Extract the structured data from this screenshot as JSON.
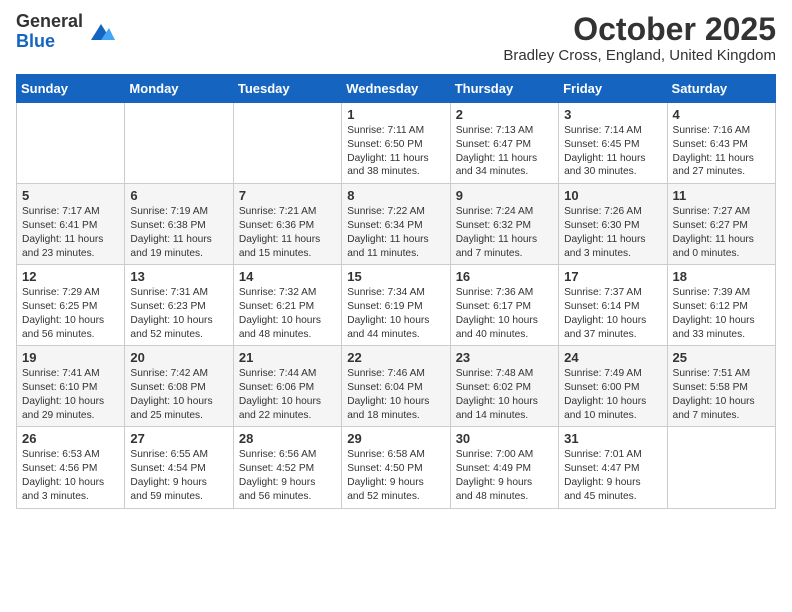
{
  "logo": {
    "general": "General",
    "blue": "Blue"
  },
  "header": {
    "month": "October 2025",
    "location": "Bradley Cross, England, United Kingdom"
  },
  "weekdays": [
    "Sunday",
    "Monday",
    "Tuesday",
    "Wednesday",
    "Thursday",
    "Friday",
    "Saturday"
  ],
  "weeks": [
    [
      {
        "day": "",
        "info": ""
      },
      {
        "day": "",
        "info": ""
      },
      {
        "day": "",
        "info": ""
      },
      {
        "day": "1",
        "info": "Sunrise: 7:11 AM\nSunset: 6:50 PM\nDaylight: 11 hours\nand 38 minutes."
      },
      {
        "day": "2",
        "info": "Sunrise: 7:13 AM\nSunset: 6:47 PM\nDaylight: 11 hours\nand 34 minutes."
      },
      {
        "day": "3",
        "info": "Sunrise: 7:14 AM\nSunset: 6:45 PM\nDaylight: 11 hours\nand 30 minutes."
      },
      {
        "day": "4",
        "info": "Sunrise: 7:16 AM\nSunset: 6:43 PM\nDaylight: 11 hours\nand 27 minutes."
      }
    ],
    [
      {
        "day": "5",
        "info": "Sunrise: 7:17 AM\nSunset: 6:41 PM\nDaylight: 11 hours\nand 23 minutes."
      },
      {
        "day": "6",
        "info": "Sunrise: 7:19 AM\nSunset: 6:38 PM\nDaylight: 11 hours\nand 19 minutes."
      },
      {
        "day": "7",
        "info": "Sunrise: 7:21 AM\nSunset: 6:36 PM\nDaylight: 11 hours\nand 15 minutes."
      },
      {
        "day": "8",
        "info": "Sunrise: 7:22 AM\nSunset: 6:34 PM\nDaylight: 11 hours\nand 11 minutes."
      },
      {
        "day": "9",
        "info": "Sunrise: 7:24 AM\nSunset: 6:32 PM\nDaylight: 11 hours\nand 7 minutes."
      },
      {
        "day": "10",
        "info": "Sunrise: 7:26 AM\nSunset: 6:30 PM\nDaylight: 11 hours\nand 3 minutes."
      },
      {
        "day": "11",
        "info": "Sunrise: 7:27 AM\nSunset: 6:27 PM\nDaylight: 11 hours\nand 0 minutes."
      }
    ],
    [
      {
        "day": "12",
        "info": "Sunrise: 7:29 AM\nSunset: 6:25 PM\nDaylight: 10 hours\nand 56 minutes."
      },
      {
        "day": "13",
        "info": "Sunrise: 7:31 AM\nSunset: 6:23 PM\nDaylight: 10 hours\nand 52 minutes."
      },
      {
        "day": "14",
        "info": "Sunrise: 7:32 AM\nSunset: 6:21 PM\nDaylight: 10 hours\nand 48 minutes."
      },
      {
        "day": "15",
        "info": "Sunrise: 7:34 AM\nSunset: 6:19 PM\nDaylight: 10 hours\nand 44 minutes."
      },
      {
        "day": "16",
        "info": "Sunrise: 7:36 AM\nSunset: 6:17 PM\nDaylight: 10 hours\nand 40 minutes."
      },
      {
        "day": "17",
        "info": "Sunrise: 7:37 AM\nSunset: 6:14 PM\nDaylight: 10 hours\nand 37 minutes."
      },
      {
        "day": "18",
        "info": "Sunrise: 7:39 AM\nSunset: 6:12 PM\nDaylight: 10 hours\nand 33 minutes."
      }
    ],
    [
      {
        "day": "19",
        "info": "Sunrise: 7:41 AM\nSunset: 6:10 PM\nDaylight: 10 hours\nand 29 minutes."
      },
      {
        "day": "20",
        "info": "Sunrise: 7:42 AM\nSunset: 6:08 PM\nDaylight: 10 hours\nand 25 minutes."
      },
      {
        "day": "21",
        "info": "Sunrise: 7:44 AM\nSunset: 6:06 PM\nDaylight: 10 hours\nand 22 minutes."
      },
      {
        "day": "22",
        "info": "Sunrise: 7:46 AM\nSunset: 6:04 PM\nDaylight: 10 hours\nand 18 minutes."
      },
      {
        "day": "23",
        "info": "Sunrise: 7:48 AM\nSunset: 6:02 PM\nDaylight: 10 hours\nand 14 minutes."
      },
      {
        "day": "24",
        "info": "Sunrise: 7:49 AM\nSunset: 6:00 PM\nDaylight: 10 hours\nand 10 minutes."
      },
      {
        "day": "25",
        "info": "Sunrise: 7:51 AM\nSunset: 5:58 PM\nDaylight: 10 hours\nand 7 minutes."
      }
    ],
    [
      {
        "day": "26",
        "info": "Sunrise: 6:53 AM\nSunset: 4:56 PM\nDaylight: 10 hours\nand 3 minutes."
      },
      {
        "day": "27",
        "info": "Sunrise: 6:55 AM\nSunset: 4:54 PM\nDaylight: 9 hours\nand 59 minutes."
      },
      {
        "day": "28",
        "info": "Sunrise: 6:56 AM\nSunset: 4:52 PM\nDaylight: 9 hours\nand 56 minutes."
      },
      {
        "day": "29",
        "info": "Sunrise: 6:58 AM\nSunset: 4:50 PM\nDaylight: 9 hours\nand 52 minutes."
      },
      {
        "day": "30",
        "info": "Sunrise: 7:00 AM\nSunset: 4:49 PM\nDaylight: 9 hours\nand 48 minutes."
      },
      {
        "day": "31",
        "info": "Sunrise: 7:01 AM\nSunset: 4:47 PM\nDaylight: 9 hours\nand 45 minutes."
      },
      {
        "day": "",
        "info": ""
      }
    ]
  ]
}
